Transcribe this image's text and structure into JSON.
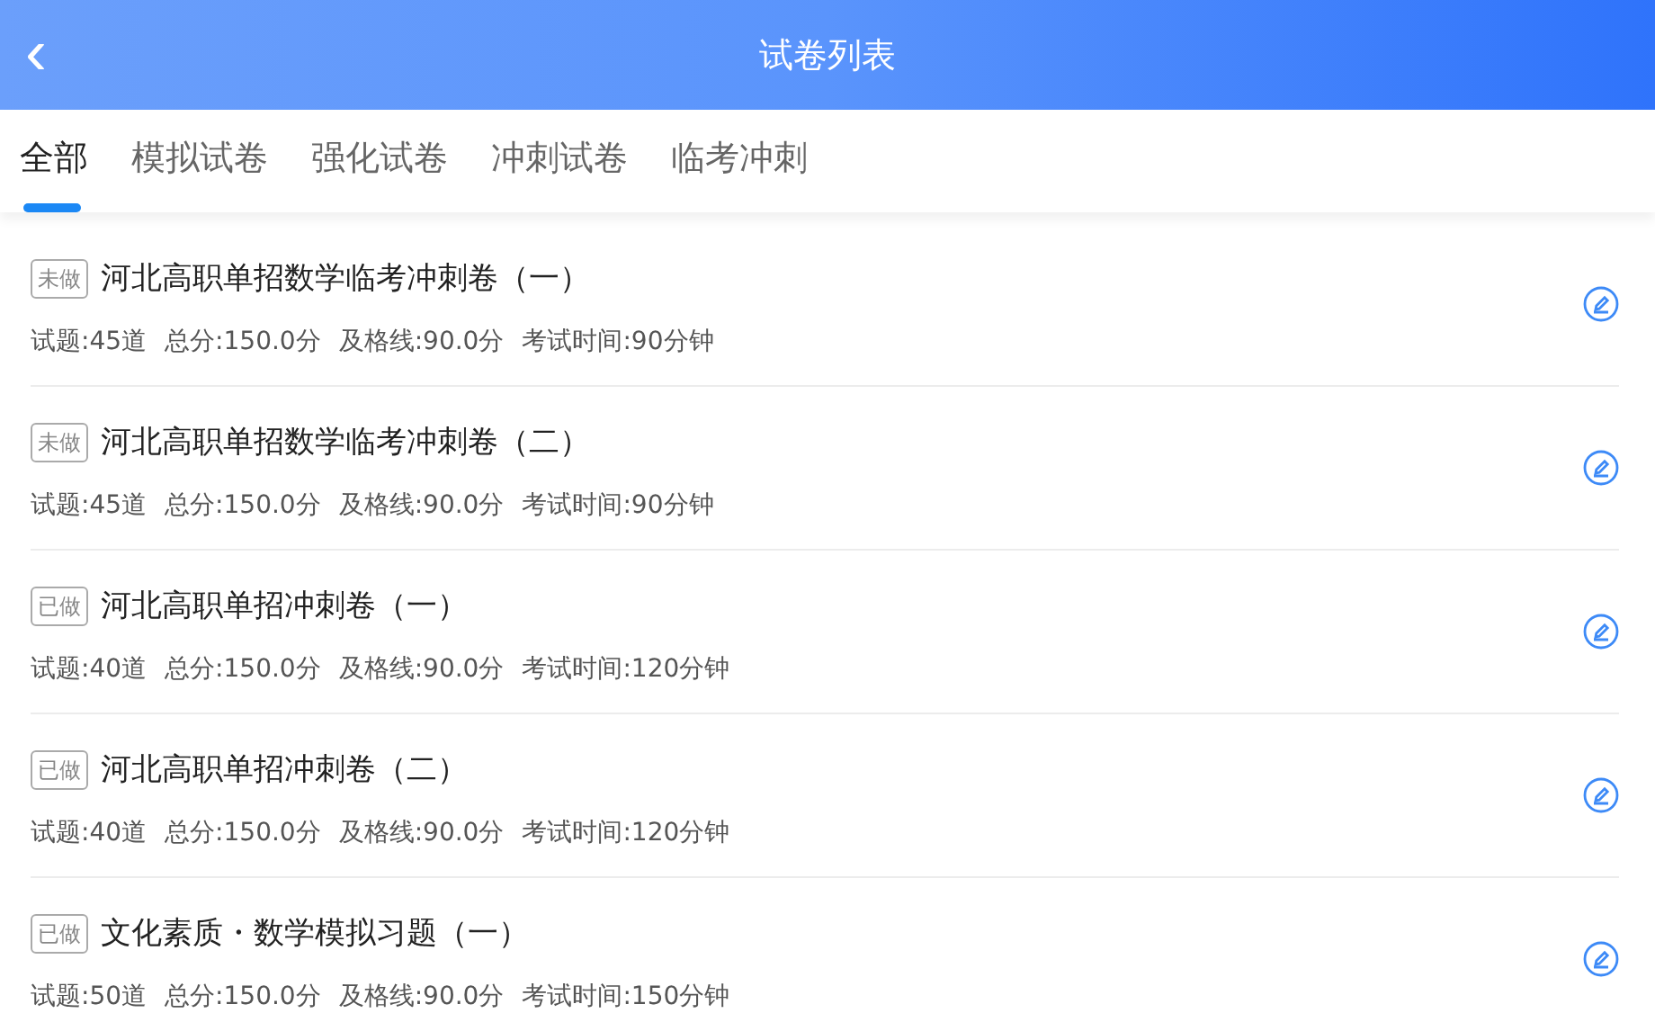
{
  "header": {
    "back": "‹",
    "title": "试卷列表"
  },
  "tabs": [
    {
      "label": "全部",
      "selected": true
    },
    {
      "label": "模拟试卷",
      "selected": false
    },
    {
      "label": "强化试卷",
      "selected": false
    },
    {
      "label": "冲刺试卷",
      "selected": false
    },
    {
      "label": "临考冲刺",
      "selected": false
    }
  ],
  "papers": [
    {
      "status": "未做",
      "title": "河北高职单招数学临考冲刺卷（一）",
      "meta": [
        "试题:45道",
        "总分:150.0分",
        "及格线:90.0分",
        "考试时间:90分钟"
      ]
    },
    {
      "status": "未做",
      "title": "河北高职单招数学临考冲刺卷（二）",
      "meta": [
        "试题:45道",
        "总分:150.0分",
        "及格线:90.0分",
        "考试时间:90分钟"
      ]
    },
    {
      "status": "已做",
      "title": "河北高职单招冲刺卷（一）",
      "meta": [
        "试题:40道",
        "总分:150.0分",
        "及格线:90.0分",
        "考试时间:120分钟"
      ]
    },
    {
      "status": "已做",
      "title": "河北高职单招冲刺卷（二）",
      "meta": [
        "试题:40道",
        "总分:150.0分",
        "及格线:90.0分",
        "考试时间:120分钟"
      ]
    },
    {
      "status": "已做",
      "title": "文化素质・数学模拟习题（一）",
      "meta": [
        "试题:50道",
        "总分:150.0分",
        "及格线:90.0分",
        "考试时间:150分钟"
      ]
    }
  ]
}
